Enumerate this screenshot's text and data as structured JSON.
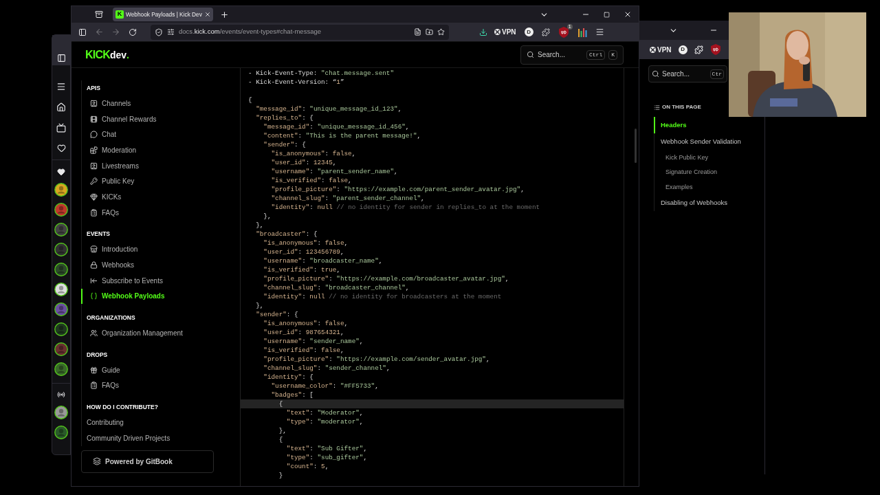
{
  "browser": {
    "tab": {
      "title": "Webhook Payloads | Kick Dev",
      "favicon": "K"
    },
    "navigation": {
      "back": {
        "disabled": true
      },
      "forward": {
        "disabled": true
      }
    },
    "url": {
      "prefix": "docs.",
      "domain": "kick.com",
      "path": "/events/event-types#chat-message"
    },
    "vpn": "VPN",
    "profile": "D",
    "blocker_count": "1"
  },
  "page": {
    "logo": {
      "mark": "KICK",
      "suffix": "dev",
      "dot": "."
    },
    "search": {
      "placeholder": "Search...",
      "keys": [
        "Ctrl",
        "K"
      ]
    },
    "sidebar": [
      {
        "title": "APIS",
        "items": [
          {
            "label": "Channels",
            "selected": false
          },
          {
            "label": "Channel Rewards",
            "selected": false
          },
          {
            "label": "Chat",
            "selected": false
          },
          {
            "label": "Moderation",
            "selected": false
          },
          {
            "label": "Livestreams",
            "selected": false
          },
          {
            "label": "Public Key",
            "selected": false
          },
          {
            "label": "KICKs",
            "selected": false
          },
          {
            "label": "FAQs",
            "selected": false
          }
        ]
      },
      {
        "title": "EVENTS",
        "items": [
          {
            "label": "Introduction",
            "selected": false
          },
          {
            "label": "Webhooks",
            "selected": false
          },
          {
            "label": "Subscribe to Events",
            "selected": false
          },
          {
            "label": "Webhook Payloads",
            "selected": true
          }
        ]
      },
      {
        "title": "ORGANIZATIONS",
        "items": [
          {
            "label": "Organization Management",
            "selected": false
          }
        ]
      },
      {
        "title": "DROPS",
        "items": [
          {
            "label": "Guide",
            "selected": false
          },
          {
            "label": "FAQs",
            "selected": false
          }
        ]
      },
      {
        "title": "HOW DO I CONTRIBUTE?",
        "items": [
          {
            "label": "Contributing",
            "selected": false
          },
          {
            "label": "Community Driven Projects",
            "selected": false
          }
        ]
      }
    ],
    "powered_by": "Powered by GitBook",
    "code_lines": [
      {
        "text": "- Kick-Event-Type: \"chat.message.sent\"",
        "highlighted": false
      },
      {
        "text": "- Kick-Event-Version: “1”",
        "highlighted": false
      },
      {
        "highlighted": false
      },
      {
        "text": "{",
        "highlighted": false
      },
      {
        "text": "  \"message_id\": \"unique_message_id_123\",",
        "highlighted": false
      },
      {
        "text": "  \"replies_to\": {",
        "highlighted": false
      },
      {
        "text": "    \"message_id\": \"unique_message_id_456\",",
        "highlighted": false
      },
      {
        "text": "    \"content\": \"This is the parent message!\",",
        "highlighted": false
      },
      {
        "text": "    \"sender\": {",
        "highlighted": false
      },
      {
        "text": "      \"is_anonymous\": false,",
        "highlighted": false
      },
      {
        "text": "      \"user_id\": 12345,",
        "highlighted": false
      },
      {
        "text": "      \"username\": \"parent_sender_name\",",
        "highlighted": false
      },
      {
        "text": "      \"is_verified\": false,",
        "highlighted": false
      },
      {
        "text": "      \"profile_picture\": \"https://example.com/parent_sender_avatar.jpg\",",
        "highlighted": false
      },
      {
        "text": "      \"channel_slug\": \"parent_sender_channel\",",
        "highlighted": false
      },
      {
        "text": "      \"identity\": null // no identity for sender in replies_to at the moment",
        "highlighted": false
      },
      {
        "text": "    },",
        "highlighted": false
      },
      {
        "text": "  },",
        "highlighted": false
      },
      {
        "text": "  \"broadcaster\": {",
        "highlighted": false
      },
      {
        "text": "    \"is_anonymous\": false,",
        "highlighted": false
      },
      {
        "text": "    \"user_id\": 123456789,",
        "highlighted": false
      },
      {
        "text": "    \"username\": \"broadcaster_name\",",
        "highlighted": false
      },
      {
        "text": "    \"is_verified\": true,",
        "highlighted": false
      },
      {
        "text": "    \"profile_picture\": \"https://example.com/broadcaster_avatar.jpg\",",
        "highlighted": false
      },
      {
        "text": "    \"channel_slug\": \"broadcaster_channel\",",
        "highlighted": false
      },
      {
        "text": "    \"identity\": null // no identity for broadcasters at the moment",
        "highlighted": false
      },
      {
        "text": "  },",
        "highlighted": false
      },
      {
        "text": "  \"sender\": {",
        "highlighted": false
      },
      {
        "text": "    \"is_anonymous\": false,",
        "highlighted": false
      },
      {
        "text": "    \"user_id\": 987654321,",
        "highlighted": false
      },
      {
        "text": "    \"username\": \"sender_name\",",
        "highlighted": false
      },
      {
        "text": "    \"is_verified\": false,",
        "highlighted": false
      },
      {
        "text": "    \"profile_picture\": \"https://example.com/sender_avatar.jpg\",",
        "highlighted": false
      },
      {
        "text": "    \"channel_slug\": \"sender_channel\",",
        "highlighted": false
      },
      {
        "text": "    \"identity\": {",
        "highlighted": false
      },
      {
        "text": "      \"username_color\": \"#FF5733\",",
        "highlighted": false
      },
      {
        "text": "      \"badges\": [",
        "highlighted": false
      },
      {
        "text": "        {",
        "highlighted": true
      },
      {
        "text": "          \"text\": \"Moderator\",",
        "highlighted": false
      },
      {
        "text": "          \"type\": \"moderator\",",
        "highlighted": false
      },
      {
        "text": "        },",
        "highlighted": false
      },
      {
        "text": "        {",
        "highlighted": false
      },
      {
        "text": "          \"text\": \"Sub Gifter\",",
        "highlighted": false
      },
      {
        "text": "          \"type\": \"sub_gifter\",",
        "highlighted": false
      },
      {
        "text": "          \"count\": 5,",
        "highlighted": false
      },
      {
        "text": "        }",
        "highlighted": false
      }
    ]
  },
  "back_window": {
    "vpn": "VPN",
    "profile": "D",
    "search": {
      "placeholder": "Search...",
      "key": "Ctr"
    },
    "on_this_page": {
      "title": "ON THIS PAGE",
      "items": [
        {
          "label": "Headers",
          "selected": true
        },
        {
          "label": "Webhook Sender Validation",
          "selected": false,
          "children": [
            {
              "label": "Kick Public Key",
              "selected": false
            },
            {
              "label": "Signature Creation",
              "selected": false
            },
            {
              "label": "Examples",
              "selected": false
            }
          ]
        },
        {
          "label": "Disabling of Webhooks",
          "selected": false
        }
      ]
    }
  }
}
